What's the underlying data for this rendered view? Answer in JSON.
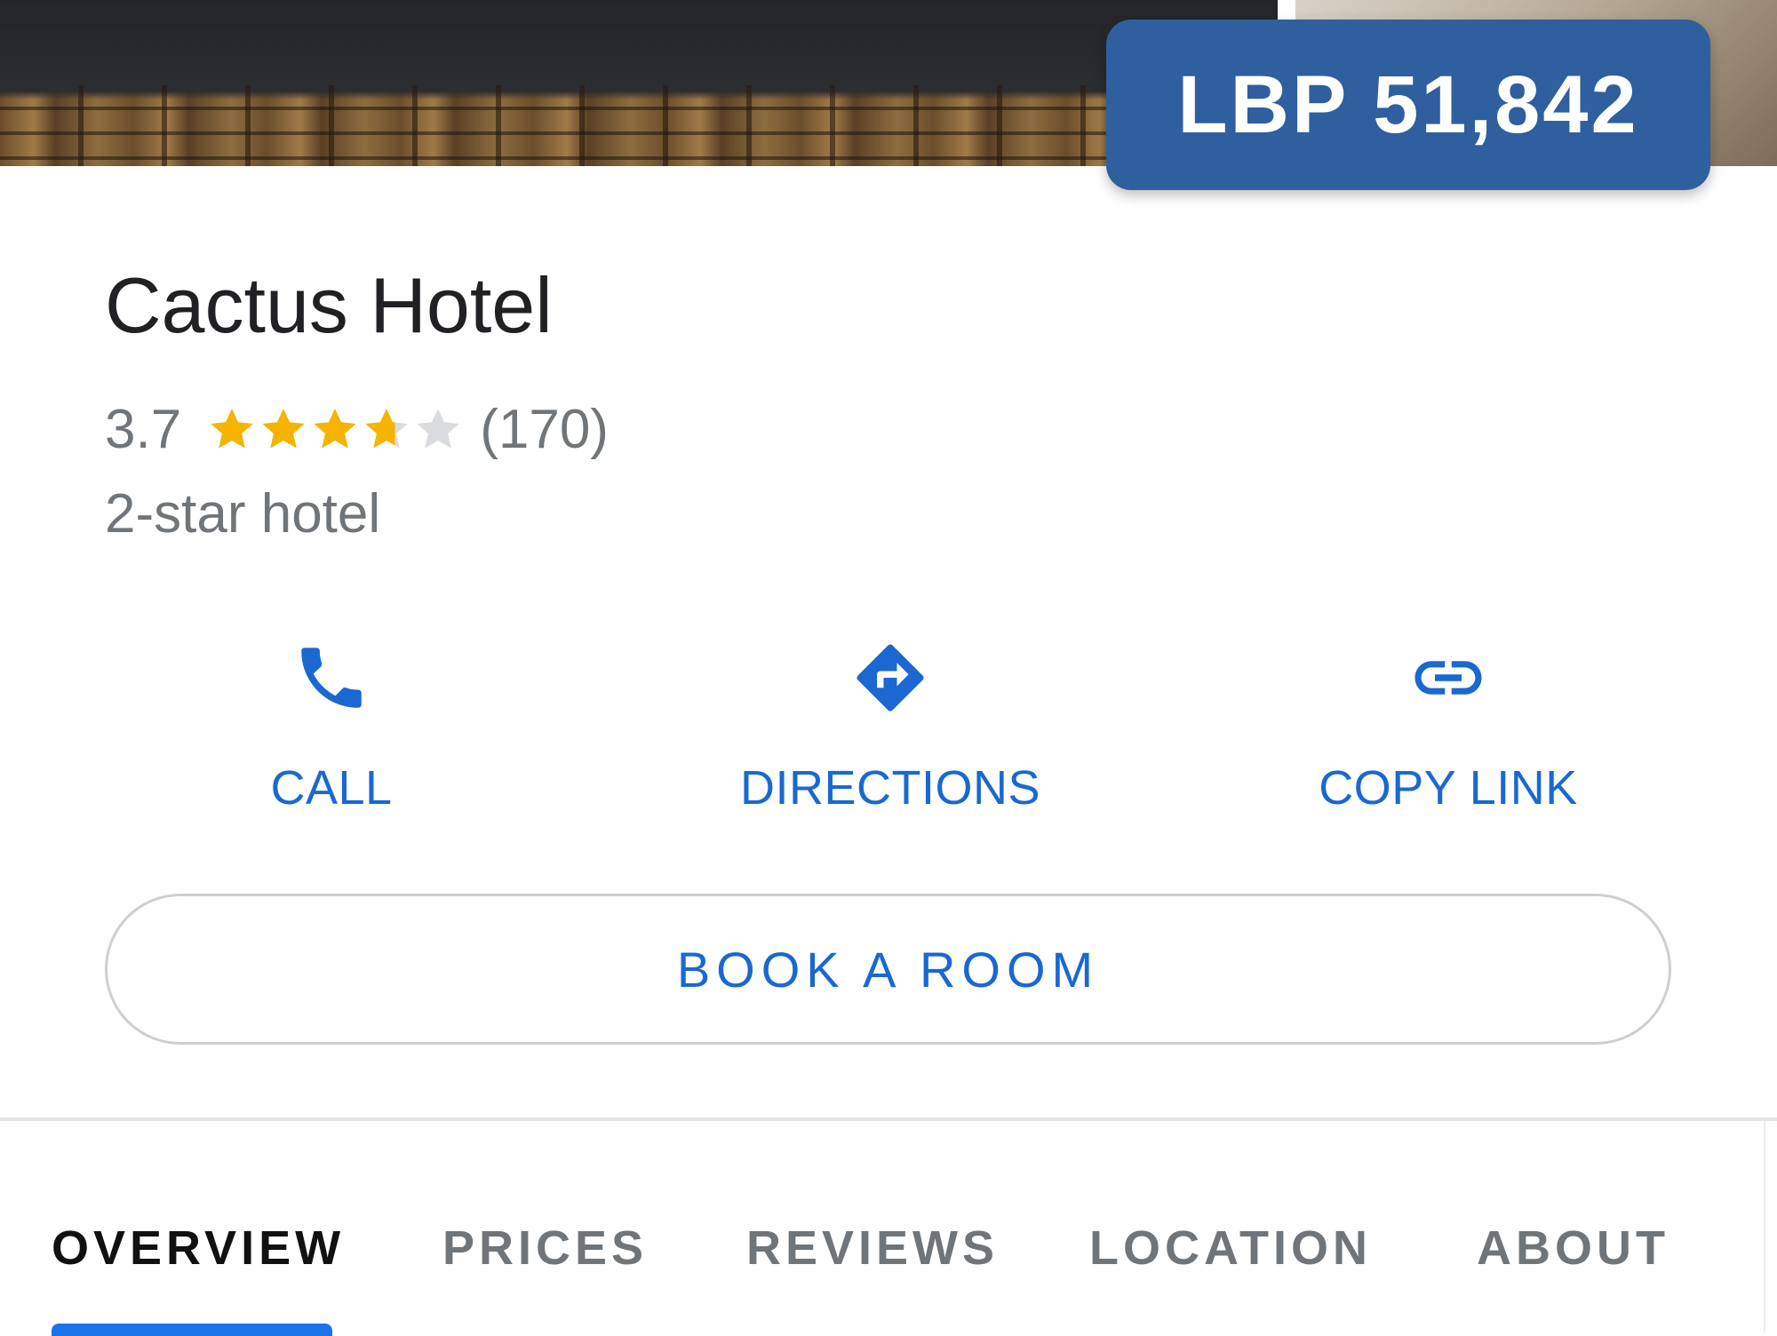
{
  "price": {
    "label": "LBP 51,842"
  },
  "hotel": {
    "name": "Cactus Hotel",
    "rating": "3.7",
    "rating_value": 3.7,
    "max_rating": 5,
    "review_count": "(170)",
    "hotel_class": "2-star hotel"
  },
  "actions": {
    "call": {
      "label": "CALL",
      "icon": "phone-icon"
    },
    "directions": {
      "label": "DIRECTIONS",
      "icon": "directions-icon"
    },
    "copy_link": {
      "label": "COPY LINK",
      "icon": "link-icon"
    }
  },
  "book_button": {
    "label": "BOOK A ROOM"
  },
  "tabs": [
    {
      "label": "OVERVIEW",
      "active": true
    },
    {
      "label": "PRICES",
      "active": false
    },
    {
      "label": "REVIEWS",
      "active": false
    },
    {
      "label": "LOCATION",
      "active": false
    },
    {
      "label": "ABOUT",
      "active": false
    }
  ],
  "colors": {
    "accent": "#1a68d0",
    "price_badge": "#2f5f9e",
    "star_filled": "#f4b400",
    "star_empty": "#dadce0",
    "text_primary": "#202124",
    "text_secondary": "#70757a"
  }
}
